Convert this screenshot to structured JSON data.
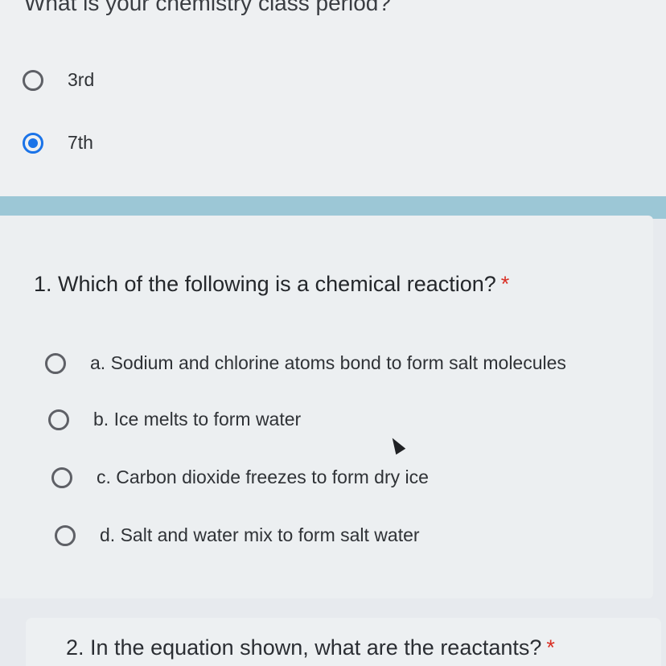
{
  "previous_question": {
    "title": "What is your chemistry class period?",
    "options": [
      {
        "label": "3rd",
        "selected": false
      },
      {
        "label": "7th",
        "selected": true
      }
    ]
  },
  "question1": {
    "title": "1. Which of the following is a chemical reaction?",
    "required_marker": "*",
    "options": [
      {
        "label": "a. Sodium and chlorine atoms bond to form salt molecules",
        "selected": false
      },
      {
        "label": "b. Ice melts to form water",
        "selected": false
      },
      {
        "label": "c. Carbon dioxide freezes to form dry ice",
        "selected": false
      },
      {
        "label": "d. Salt and water mix to form salt water",
        "selected": false
      }
    ]
  },
  "question2": {
    "title": "2. In the equation shown, what are the reactants?",
    "required_marker": "*"
  },
  "colors": {
    "accent": "#1a73e8",
    "required": "#d93025",
    "section_band": "#9cc7d6"
  }
}
